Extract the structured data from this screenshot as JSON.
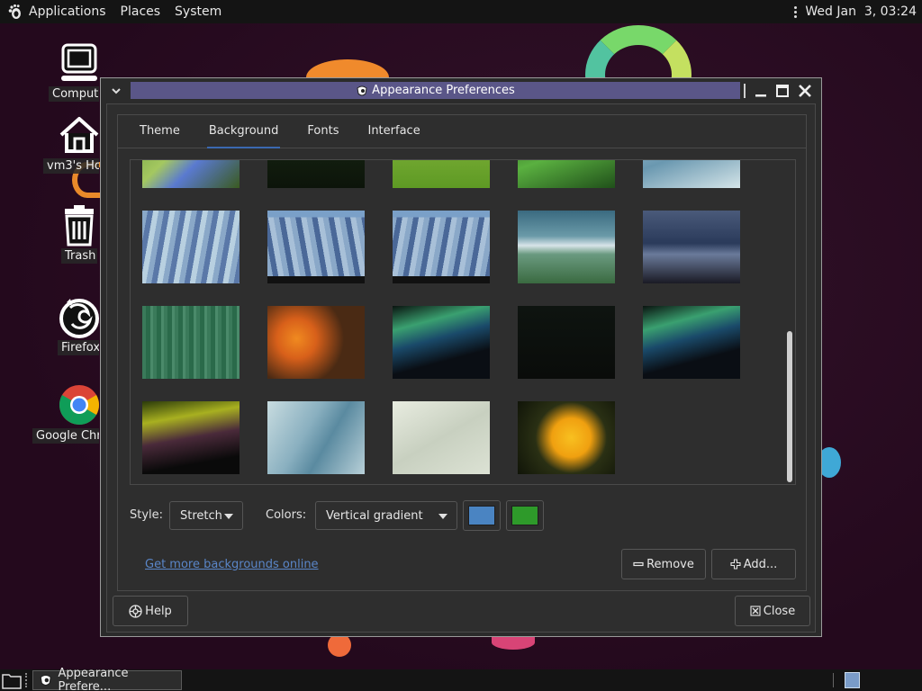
{
  "top_panel": {
    "menus": [
      "Applications",
      "Places",
      "System"
    ],
    "clock": "Wed Jan  3, 03:24"
  },
  "desktop": {
    "icons": [
      {
        "label": "Computer",
        "icon": "computer-icon"
      },
      {
        "label": "vm3's Home",
        "icon": "home-folder-icon"
      },
      {
        "label": "Trash",
        "icon": "trash-icon"
      },
      {
        "label": "Firefox",
        "icon": "firefox-icon"
      },
      {
        "label": "Google Chrome",
        "icon": "chrome-icon"
      }
    ]
  },
  "window": {
    "title": "Appearance Preferences",
    "tabs": [
      "Theme",
      "Background",
      "Fonts",
      "Interface"
    ],
    "active_tab": "Background",
    "style_label": "Style:",
    "style_value": "Stretch",
    "colors_label": "Colors:",
    "colors_value": "Vertical gradient",
    "primary_color": "#4a84c2",
    "secondary_color": "#2e9a2a",
    "link_text": "Get more backgrounds online",
    "remove_label": "Remove",
    "add_label": "Add...",
    "help_label": "Help",
    "close_label": "Close"
  },
  "taskbar": {
    "task_label": "Appearance Prefere..."
  },
  "colors": {
    "title_bar": "#5a5688",
    "active_tab_underline": "#3a68b0",
    "link": "#5a86c8"
  }
}
